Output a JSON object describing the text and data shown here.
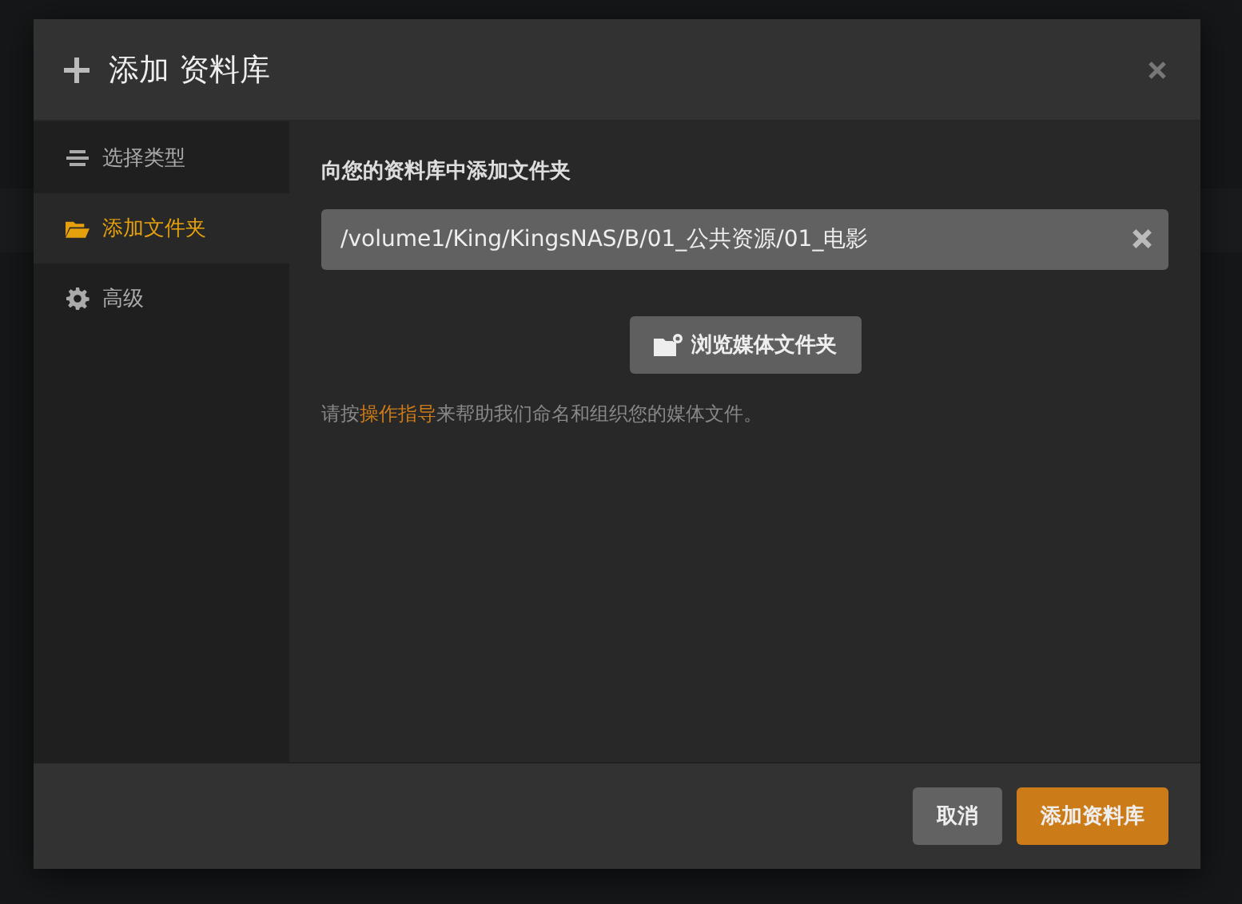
{
  "dialog": {
    "title": "添加 资料库",
    "sidebar": {
      "items": [
        {
          "label": "选择类型",
          "kind": "type",
          "selected": false
        },
        {
          "label": "添加文件夹",
          "kind": "folder",
          "selected": true
        },
        {
          "label": "高级",
          "kind": "advanced",
          "selected": false
        }
      ]
    },
    "heading": "向您的资料库中添加文件夹",
    "path_field": {
      "value": "/volume1/King/KingsNAS/B/01_公共资源/01_电影"
    },
    "browse_button": "浏览媒体文件夹",
    "help": {
      "before": "请按",
      "link": "操作指导",
      "after": "来帮助我们命名和组织您的媒体文件。"
    },
    "buttons": [
      {
        "label": "取消",
        "kind": "secondary"
      },
      {
        "label": "添加资料库",
        "kind": "primary"
      }
    ]
  }
}
